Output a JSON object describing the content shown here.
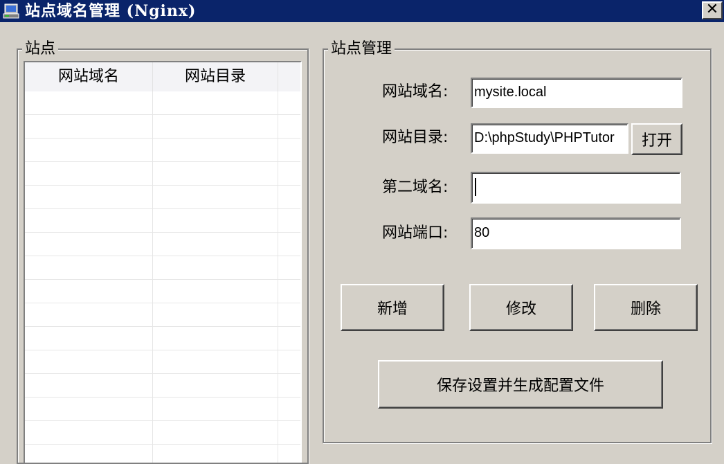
{
  "window": {
    "title": "站点域名管理 (Nginx)",
    "close_label": "✕"
  },
  "sites_group": {
    "title": "站点",
    "columns": [
      "网站域名",
      "网站目录"
    ],
    "rows": []
  },
  "manage_group": {
    "title": "站点管理",
    "fields": {
      "domain": {
        "label": "网站域名:",
        "value": "mysite.local"
      },
      "directory": {
        "label": "网站目录:",
        "value": "D:\\phpStudy\\PHPTutor"
      },
      "second_domain": {
        "label": "第二域名:",
        "value": ""
      },
      "port": {
        "label": "网站端口:",
        "value": "80"
      }
    },
    "buttons": {
      "open": "打开",
      "add": "新增",
      "modify": "修改",
      "delete": "删除",
      "save": "保存设置并生成配置文件"
    }
  },
  "colors": {
    "titlebar": "#0a246a",
    "window_bg": "#d4d0c8",
    "list_header_bg": "#f3f3f6"
  }
}
